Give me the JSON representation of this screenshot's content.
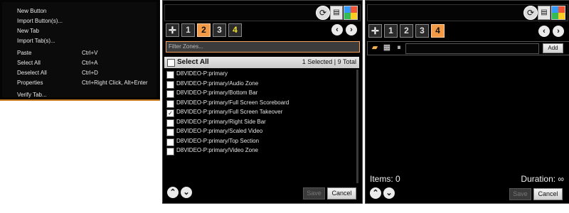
{
  "context_menu": {
    "items": [
      {
        "label": "New Button",
        "shortcut": ""
      },
      {
        "label": "Import Button(s)...",
        "shortcut": ""
      },
      {
        "label": "New Tab",
        "shortcut": ""
      },
      {
        "label": "Import Tab(s)...",
        "shortcut": ""
      },
      {
        "label": "Paste",
        "shortcut": "Ctrl+V"
      },
      {
        "label": "Select All",
        "shortcut": "Ctrl+A"
      },
      {
        "label": "Deselect All",
        "shortcut": "Ctrl+D"
      },
      {
        "label": "Properties",
        "shortcut": "Ctrl+Right Click, Alt+Enter"
      },
      {
        "label": "Verify Tab...",
        "shortcut": ""
      }
    ]
  },
  "zones": {
    "tabs": [
      "1",
      "2",
      "3",
      "4"
    ],
    "active_tab": "2",
    "filter_placeholder": "Filter Zones...",
    "select_all_label": "Select All",
    "count_text": "1 Selected | 9 Total",
    "items": [
      {
        "label": "D8VIDEO-P:primary",
        "checked": false
      },
      {
        "label": "D8VIDEO-P:primary/Audio Zone",
        "checked": false
      },
      {
        "label": "D8VIDEO-P:primary/Bottom Bar",
        "checked": false
      },
      {
        "label": "D8VIDEO-P:primary/Full Screen Scoreboard",
        "checked": false
      },
      {
        "label": "D8VIDEO-P:primary/Full Screen Takeover",
        "checked": true
      },
      {
        "label": "D8VIDEO-P:primary/Right Side Bar",
        "checked": false
      },
      {
        "label": "D8VIDEO-P:primary/Scaled Video",
        "checked": false
      },
      {
        "label": "D8VIDEO-P:primary/Top Section",
        "checked": false
      },
      {
        "label": "D8VIDEO-P:primary/Video Zone",
        "checked": false
      }
    ],
    "save_label": "Save",
    "cancel_label": "Cancel"
  },
  "playlist": {
    "tabs": [
      "1",
      "2",
      "3",
      "4"
    ],
    "active_tab": "4",
    "add_label": "Add",
    "items_text": "Items: 0",
    "duration_text": "Duration: ∞",
    "save_label": "Save",
    "cancel_label": "Cancel"
  },
  "colors": {
    "accent_orange": "#f39a46",
    "menu_border": "#c87a1e",
    "background": "#000000"
  }
}
